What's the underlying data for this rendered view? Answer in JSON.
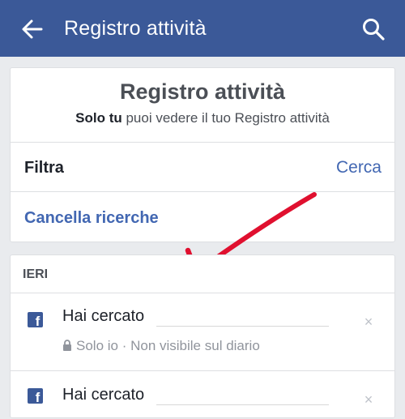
{
  "appbar": {
    "title": "Registro attività",
    "back_icon": "back-arrow-icon",
    "search_icon": "search-icon"
  },
  "header": {
    "title": "Registro attività",
    "subtitle_bold": "Solo tu",
    "subtitle_rest": " puoi vedere il tuo Registro attività"
  },
  "filters": {
    "filter_label": "Filtra",
    "search_link": "Cerca",
    "clear_searches": "Cancella ricerche"
  },
  "activity": {
    "section_title": "IERI",
    "items": [
      {
        "title": "Hai cercato",
        "privacy": "Solo io · Non visibile sul diario"
      },
      {
        "title": "Hai cercato"
      }
    ]
  },
  "colors": {
    "brand": "#3b5998",
    "link": "#4267b2",
    "annotation_arrow": "#e0102f"
  }
}
